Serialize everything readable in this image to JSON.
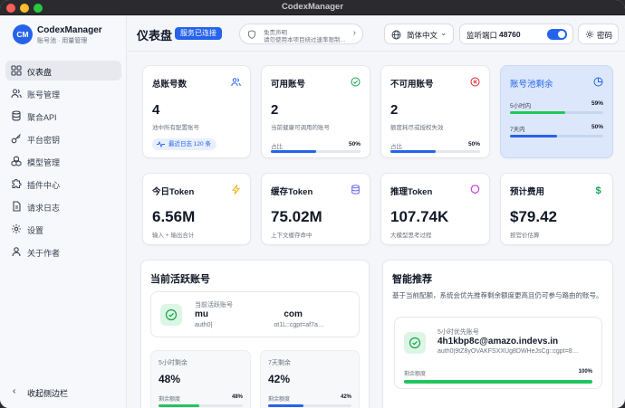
{
  "window": {
    "title": "CodexManager"
  },
  "brand": {
    "logo": "CM",
    "name": "CodexManager",
    "subtitle": "账号池 · 用量管理"
  },
  "sidebar": {
    "items": [
      {
        "label": "仪表盘",
        "icon": "grid-icon",
        "active": true
      },
      {
        "label": "账号管理",
        "icon": "users-icon"
      },
      {
        "label": "聚合API",
        "icon": "database-icon"
      },
      {
        "label": "平台密钥",
        "icon": "key-icon"
      },
      {
        "label": "模型管理",
        "icon": "cubes-icon"
      },
      {
        "label": "插件中心",
        "icon": "puzzle-icon"
      },
      {
        "label": "请求日志",
        "icon": "document-icon"
      },
      {
        "label": "设置",
        "icon": "gear-icon"
      },
      {
        "label": "关于作者",
        "icon": "user-icon"
      }
    ],
    "collapse_label": "收起侧边栏"
  },
  "header": {
    "title": "仪表盘",
    "status": "服务已连接",
    "notice_title": "免责声明",
    "notice_text": "请勿使用本项目绕过速率限制…",
    "language": "简体中文",
    "port_label": "监听端口",
    "port_value": "48760",
    "password_label": "密码"
  },
  "stats": {
    "total": {
      "title": "总账号数",
      "value": "4",
      "sub": "池中所有配置账号",
      "chip": "最近日志 120 条"
    },
    "available": {
      "title": "可用账号",
      "value": "2",
      "sub": "当前健康可调用的账号",
      "ratio_label": "占比",
      "ratio": "50%",
      "fraction": 0.5
    },
    "unavailable": {
      "title": "不可用账号",
      "value": "2",
      "sub": "额度耗尽或授权失效",
      "ratio_label": "占比",
      "ratio": "50%",
      "fraction": 0.5
    },
    "pool": {
      "title": "账号池剩余",
      "rows": [
        {
          "label": "5小时内",
          "value": "59%",
          "fraction": 0.59,
          "color": "#22c55e"
        },
        {
          "label": "7天内",
          "value": "50%",
          "fraction": 0.5,
          "color": "#2563eb"
        }
      ]
    }
  },
  "tokens": {
    "today": {
      "title": "今日Token",
      "value": "6.56M",
      "sub": "输入 + 输出合计"
    },
    "cache": {
      "title": "缓存Token",
      "value": "75.02M",
      "sub": "上下文缓存命中"
    },
    "reasoning": {
      "title": "推理Token",
      "value": "107.74K",
      "sub": "大模型思考过程"
    },
    "cost": {
      "title": "预计费用",
      "value": "$79.42",
      "sub": "按官价估算"
    }
  },
  "active": {
    "title": "当前活跃账号",
    "label": "当前活跃账号",
    "email": "mu                              com",
    "id": "auth0|                                   ot1L::cgpt=af7a…",
    "five_hour": {
      "label": "5小时剩余",
      "value": "48%",
      "quota_label": "剩余额度",
      "quota": "48%",
      "fraction": 0.48
    },
    "seven_day": {
      "label": "7天剩余",
      "value": "42%",
      "quota_label": "剩余额度",
      "quota": "42%",
      "fraction": 0.42
    }
  },
  "recommend": {
    "title": "智能推荐",
    "description": "基于当前配额，系统会优先推荐剩余额度更高且仍可参与路由的账号。",
    "label": "5小时优先账号",
    "email": "4h1kbp8c@amazo.indevs.in",
    "id": "auth0|9tZ8yOVAKFSXXUg8DWHeJsCg::cgpt=8…",
    "quota_label": "剩余额度",
    "quota": "100%",
    "fraction": 1.0
  }
}
